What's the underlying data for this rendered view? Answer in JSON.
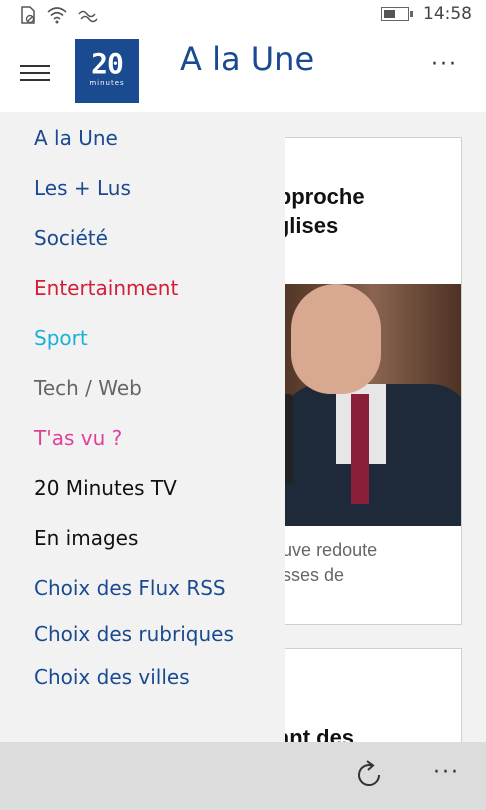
{
  "status_bar": {
    "time": "14:58",
    "icons": [
      "sim-off-icon",
      "wifi-icon",
      "data-icon",
      "battery-icon"
    ],
    "battery_level": 0.5
  },
  "app_bar": {
    "logo_number": "20",
    "logo_subtext": "minutes",
    "title": "A la Une",
    "more_label": "···"
  },
  "drawer": {
    "items": [
      {
        "label": "A la Une",
        "color": "#1a4a8f"
      },
      {
        "label": "Les + Lus",
        "color": "#1a4a8f"
      },
      {
        "label": "Société",
        "color": "#1a4a8f"
      },
      {
        "label": "Entertainment",
        "color": "#d11f3a"
      },
      {
        "label": "Sport",
        "color": "#1ab0d8"
      },
      {
        "label": "Tech / Web",
        "color": "#666666"
      },
      {
        "label": "T'as vu ?",
        "color": "#e0409a"
      },
      {
        "label": "20 Minutes TV",
        "color": "#111111"
      },
      {
        "label": "En images",
        "color": "#111111"
      },
      {
        "label": "Choix des Flux RSS",
        "color": "#1a4a8f"
      },
      {
        "label": "Choix des rubriques",
        "color": "#1a4a8f"
      },
      {
        "label": "Choix des villes",
        "color": "#1a4a8f"
      }
    ]
  },
  "articles": [
    {
      "headline": "A l'approche\nes églises",
      "excerpt": "azeneuve redoute\nes messes de"
    },
    {
      "headline": "glaçant des"
    }
  ],
  "bottom_bar": {
    "more_label": "···"
  }
}
